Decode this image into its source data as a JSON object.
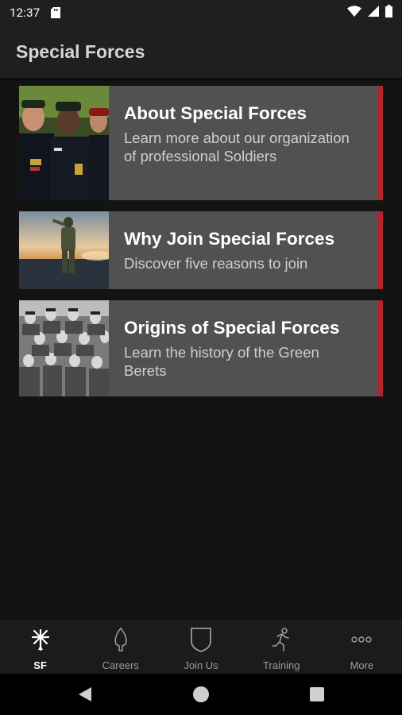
{
  "status": {
    "time": "12:37"
  },
  "app_bar": {
    "title": "Special Forces"
  },
  "cards": [
    {
      "title": "About Special Forces",
      "description": "Learn more about our organization of professional Soldiers",
      "thumbnail": "soldiers-dress-uniform-photo"
    },
    {
      "title": "Why Join Special Forces",
      "description": "Discover five reasons to join",
      "thumbnail": "soldier-saluting-sunset-photo"
    },
    {
      "title": "Origins of Special Forces",
      "description": "Learn the history of the Green Berets",
      "thumbnail": "historic-soldiers-group-photo"
    }
  ],
  "bottom_nav": [
    {
      "label": "SF",
      "icon": "sf-insignia-icon",
      "active": true
    },
    {
      "label": "Careers",
      "icon": "arrowhead-icon",
      "active": false
    },
    {
      "label": "Join Us",
      "icon": "shield-icon",
      "active": false
    },
    {
      "label": "Training",
      "icon": "running-person-icon",
      "active": false
    },
    {
      "label": "More",
      "icon": "more-dots-icon",
      "active": false
    }
  ],
  "colors": {
    "accent": "#b1252a",
    "card_bg": "#515151",
    "background": "#131313",
    "bar": "#1f1f1f"
  }
}
